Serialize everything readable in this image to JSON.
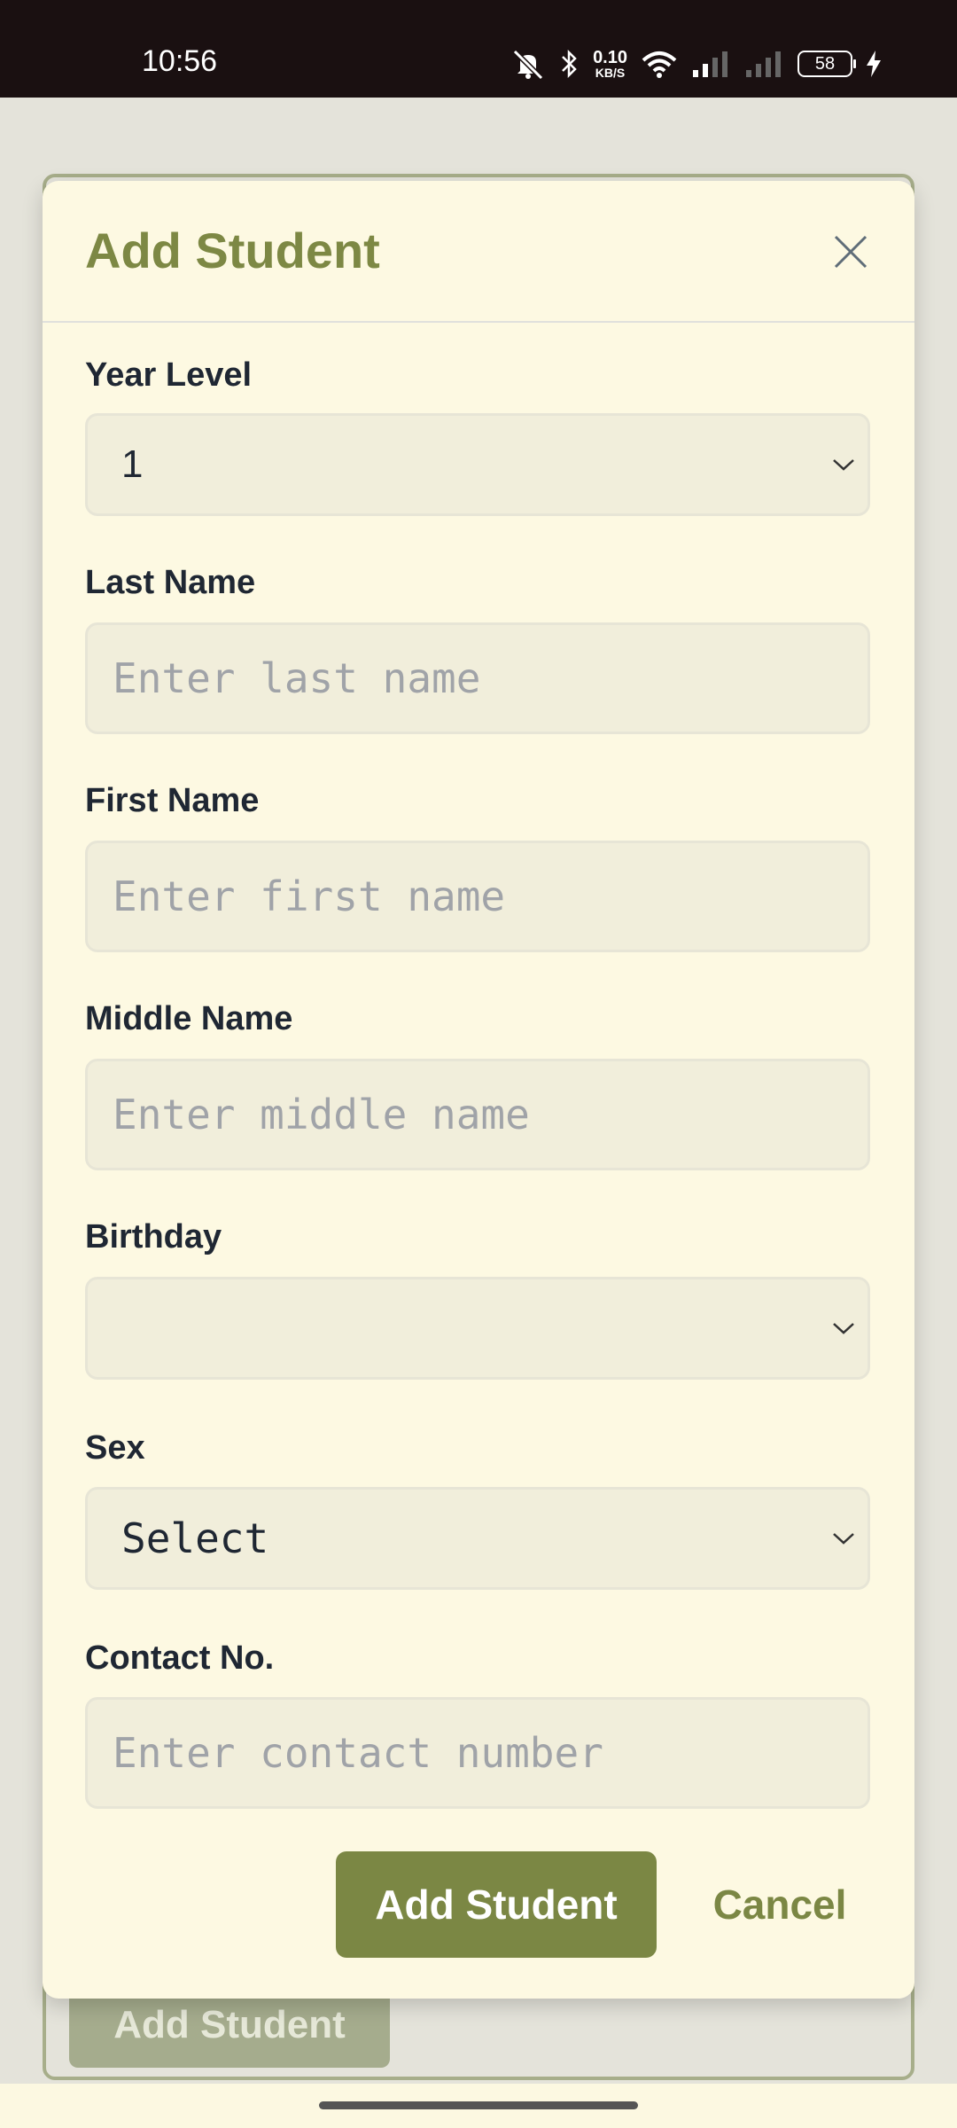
{
  "status_bar": {
    "time": "10:56",
    "net_speed_value": "0.10",
    "net_speed_unit": "KB/S",
    "battery": "58",
    "icons": [
      "mute-icon",
      "bluetooth-icon",
      "wifi-icon",
      "signal-icon",
      "signal-icon",
      "charging-icon"
    ]
  },
  "background": {
    "add_button_label": "Add Student"
  },
  "modal": {
    "title": "Add Student",
    "fields": {
      "year_level": {
        "label": "Year Level",
        "value": "1"
      },
      "last_name": {
        "label": "Last Name",
        "placeholder": "Enter last name",
        "value": ""
      },
      "first_name": {
        "label": "First Name",
        "placeholder": "Enter first name",
        "value": ""
      },
      "middle_name": {
        "label": "Middle Name",
        "placeholder": "Enter middle name",
        "value": ""
      },
      "birthday": {
        "label": "Birthday",
        "value": ""
      },
      "sex": {
        "label": "Sex",
        "value": "Select"
      },
      "contact": {
        "label": "Contact No.",
        "placeholder": "Enter contact number",
        "value": ""
      }
    },
    "submit_label": "Add Student",
    "cancel_label": "Cancel"
  },
  "colors": {
    "accent": "#7b8744",
    "modal_bg": "#fdf9e2",
    "field_bg": "#f1eedb",
    "status_bar": "#1a1011"
  }
}
